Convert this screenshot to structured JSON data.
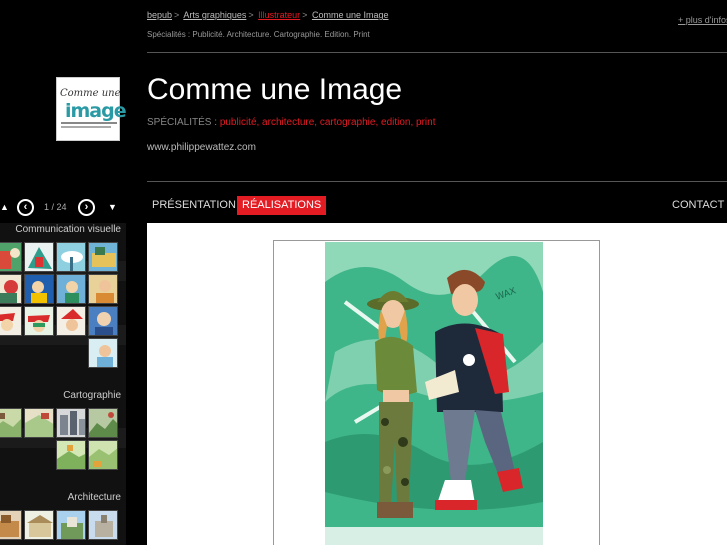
{
  "breadcrumb": {
    "items": [
      "bepub",
      "Arts graphiques",
      "Illustrateur",
      "Comme une Image"
    ],
    "separator": ">"
  },
  "more_info": "+ plus d'infos",
  "specialties_line": "Spécialités : Publicité. Architecture. Cartographie. Edition. Print",
  "logo": {
    "line1": "Comme une",
    "line2": "image"
  },
  "page_title": "Comme une Image",
  "specialties": {
    "label": "SPÉCIALITÉS :",
    "values": "publicité, architecture, cartographie, edition, print"
  },
  "website": "www.philippewattez.com",
  "nav": {
    "presentation": "PRÉSENTATION",
    "realisations": "RÉALISATIONS",
    "contact": "CONTACT"
  },
  "pager": {
    "count": "1 / 24",
    "prev": "‹",
    "next": "›",
    "up": "▲",
    "down": "▼"
  },
  "sidebar": {
    "sections": [
      "Communication visuelle",
      "Cartographie",
      "Architecture"
    ]
  },
  "colors": {
    "accent": "#e31b23",
    "logo_teal": "#2a9aa5",
    "background": "#000000"
  }
}
